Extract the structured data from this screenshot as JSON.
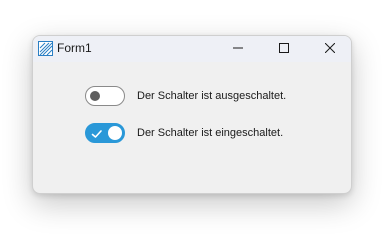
{
  "window": {
    "title": "Form1",
    "icon": "form-icon",
    "controls": {
      "minimize_icon": "minimize-icon",
      "maximize_icon": "maximize-icon",
      "close_icon": "close-icon"
    }
  },
  "switches": [
    {
      "state": "off",
      "label": "Der Schalter ist ausgeschaltet."
    },
    {
      "state": "on",
      "icon": "checkmark-icon",
      "label": "Der Schalter ist eingeschaltet."
    }
  ],
  "colors": {
    "accent": "#2a98d8",
    "window_background": "#f0f0f0",
    "titlebar_background": "#eef0f6",
    "toggle_off_knob": "#5f5f5f"
  }
}
